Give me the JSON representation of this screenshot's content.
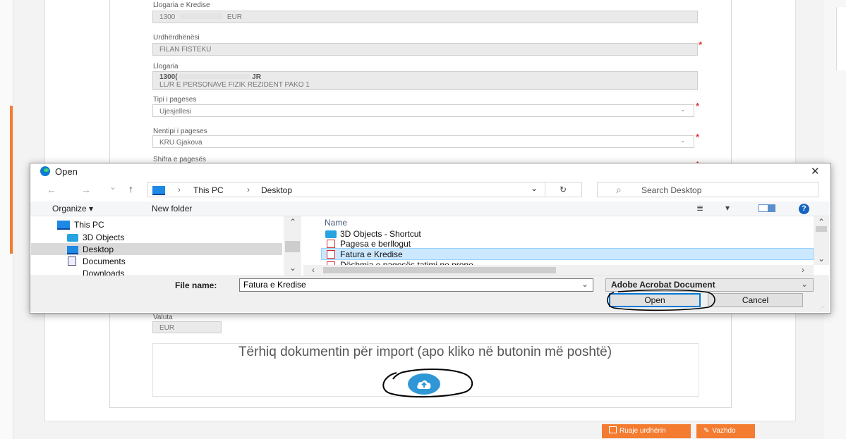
{
  "form": {
    "account_top_label": "Llogaria e Kredise",
    "account_top_value": "1300",
    "account_top_currency": "EUR",
    "payer_label": "Urdhërdhënësi",
    "payer_value": "FILAN FISTEKU",
    "account_label": "Llogaria",
    "account_number": "1300(",
    "account_suffix": "JR",
    "account_desc": "LL/R E PERSONAVE FIZIK REZIDENT PAKO 1",
    "payment_type_label": "Tipi i pageses",
    "payment_type_value": "Ujesjellesi",
    "payment_subtype_label": "Nentipi i pageses",
    "payment_subtype_value": "KRU Gjakova",
    "payment_code_label": "Shifra e pagesës",
    "currency_label": "Valuta",
    "currency_value": "EUR",
    "required_mark": "*",
    "dropdown_caret": "⌄"
  },
  "upload": {
    "drop_text": "Tërhiq dokumentin për import (apo kliko në butonin më poshtë)",
    "icon": "cloud-upload-icon",
    "accent_color": "#2f97d6"
  },
  "actions": {
    "save_label": "Ruaje urdhërin",
    "continue_label": "Vazhdo",
    "accent_color": "#f47c30"
  },
  "dialog": {
    "title": "Open",
    "close_glyph": "✕",
    "nav": {
      "back": "←",
      "forward": "→",
      "recent": "⌄",
      "up": "↑",
      "sep": "›",
      "breadcrumb": [
        "This PC",
        "Desktop"
      ],
      "dropdown": "⌄",
      "refresh": "↻",
      "search_placeholder": "Search Desktop",
      "search_icon": "⌕"
    },
    "toolbar": {
      "organize": "Organize",
      "organize_caret": "▾",
      "new_folder": "New folder",
      "view_icon": "≣",
      "view_caret": "▾",
      "help": "?"
    },
    "tree": [
      "This PC",
      "3D Objects",
      "Desktop",
      "Documents",
      "Downloads"
    ],
    "files_header": "Name",
    "files": [
      "3D Objects - Shortcut",
      "Pagesa e berllogut",
      "Fatura e Kredise",
      "Dëshmia e pagesës tatimi ne prone"
    ],
    "file_name_label": "File name:",
    "file_name_value": "Fatura e Kredise",
    "file_type_value": "Adobe Acrobat Document",
    "open_label": "Open",
    "cancel_label": "Cancel",
    "scroll": {
      "up": "⌃",
      "down": "⌄",
      "left": "‹",
      "right": "›"
    }
  }
}
